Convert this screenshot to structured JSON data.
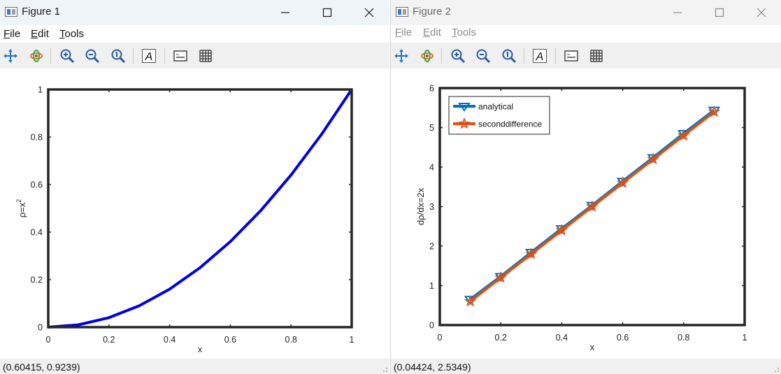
{
  "figure1": {
    "title": "Figure 1",
    "menu": [
      {
        "label": "File",
        "key": "F",
        "rest": "ile"
      },
      {
        "label": "Edit",
        "key": "E",
        "rest": "dit"
      },
      {
        "label": "Tools",
        "key": "T",
        "rest": "ools"
      }
    ],
    "toolbar": [
      "pan-icon",
      "rotate-icon",
      "zoom-in-icon",
      "zoom-out-icon",
      "zoom-reset-icon",
      "insert-text-icon",
      "legend-icon",
      "grid-icon"
    ],
    "status": "(0.60415, 0.9239)"
  },
  "figure2": {
    "title": "Figure 2",
    "menu": [
      {
        "label": "File",
        "key": "F",
        "rest": "ile"
      },
      {
        "label": "Edit",
        "key": "E",
        "rest": "dit"
      },
      {
        "label": "Tools",
        "key": "T",
        "rest": "ools"
      }
    ],
    "toolbar": [
      "pan-icon",
      "rotate-icon",
      "zoom-in-icon",
      "zoom-out-icon",
      "zoom-reset-icon",
      "insert-text-icon",
      "legend-icon",
      "grid-icon"
    ],
    "status": "(0.04424, 2.5349)"
  },
  "colors": {
    "blue_line": "#0000e6",
    "analytical": "#0072bd",
    "seconddifference": "#d95319",
    "axes": "#262626"
  },
  "chart_data": [
    {
      "type": "line",
      "xlabel": "x",
      "ylabel_base": "ρ=x",
      "ylabel_sup": "2",
      "xlim": [
        0,
        1
      ],
      "ylim": [
        0,
        1
      ],
      "xticks": [
        "0",
        "0.2",
        "0.4",
        "0.6",
        "0.8",
        "1"
      ],
      "yticks": [
        "0",
        "0.2",
        "0.4",
        "0.6",
        "0.8",
        "1"
      ],
      "x": [
        0,
        0.1,
        0.2,
        0.3,
        0.4,
        0.5,
        0.6,
        0.7,
        0.8,
        0.9,
        1.0
      ],
      "y": [
        0,
        0.01,
        0.04,
        0.09,
        0.16,
        0.25,
        0.36,
        0.49,
        0.64,
        0.81,
        1.0
      ],
      "grid": false
    },
    {
      "type": "line",
      "xlabel": "x",
      "ylabel": "dρ/dx=2x",
      "xlim": [
        0,
        1
      ],
      "ylim": [
        0,
        6
      ],
      "xticks": [
        "0",
        "0.2",
        "0.4",
        "0.6",
        "0.8",
        "1"
      ],
      "yticks": [
        "0",
        "1",
        "2",
        "3",
        "4",
        "5",
        "6"
      ],
      "x": [
        0.1,
        0.2,
        0.3,
        0.4,
        0.5,
        0.6,
        0.7,
        0.8,
        0.9
      ],
      "series": [
        {
          "name": "analytical",
          "marker": "triangle-down",
          "values": [
            0.65,
            1.23,
            1.84,
            2.44,
            3.03,
            3.64,
            4.24,
            4.85,
            5.44
          ]
        },
        {
          "name": "seconddifference",
          "marker": "star",
          "values": [
            0.6,
            1.2,
            1.8,
            2.4,
            3.0,
            3.6,
            4.2,
            4.8,
            5.4
          ]
        }
      ],
      "legend": "top-left",
      "grid": false
    }
  ]
}
